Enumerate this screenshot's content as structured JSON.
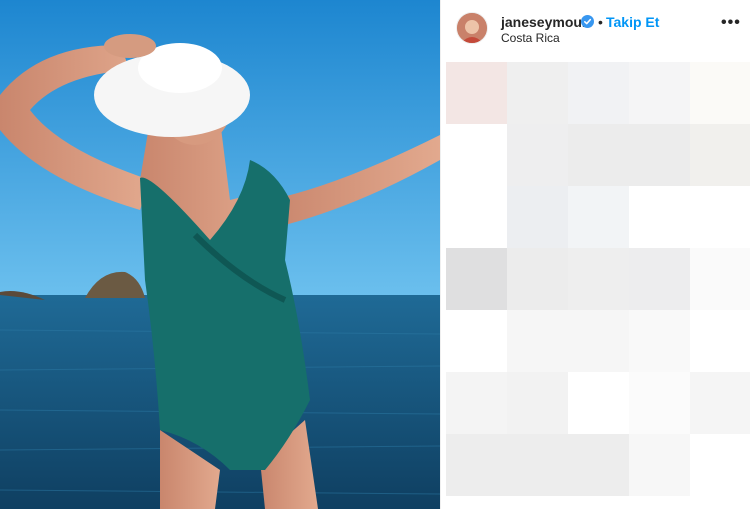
{
  "post": {
    "username": "janeseymour",
    "verified": true,
    "separator": "•",
    "follow_label": "Takip Et",
    "location": "Costa Rica",
    "more_icon": "more-options-icon",
    "photo_description_icon": "post-photo"
  },
  "colors": {
    "accent": "#0095f6",
    "sky": "#1f8fd6",
    "sea": "#1a5c86",
    "swimsuit": "#146e6a"
  },
  "blur_cells": [
    [
      "#f3e6e4",
      "#efefef",
      "#f1f2f4",
      "#f5f5f6",
      "#fbfaf7"
    ],
    [
      "#ffffff",
      "#eeeeef",
      "#ececec",
      "#ececec",
      "#f1f0ed"
    ],
    [
      "#ffffff",
      "#eceef1",
      "#f2f4f6",
      "#ffffff",
      "#ffffff"
    ],
    [
      "#dfdfe0",
      "#ececec",
      "#eeeeee",
      "#ededee",
      "#fafafa"
    ],
    [
      "#ffffff",
      "#f6f6f6",
      "#f6f6f6",
      "#f9f9f9",
      "#ffffff"
    ],
    [
      "#f4f4f4",
      "#f2f2f2",
      "#ffffff",
      "#fbfbfb",
      "#f5f5f5"
    ],
    [
      "#ededed",
      "#ededed",
      "#ededed",
      "#f7f7f7",
      "#ffffff"
    ]
  ]
}
